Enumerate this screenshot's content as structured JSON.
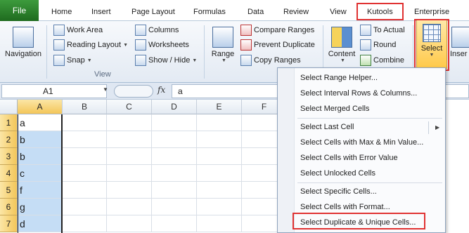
{
  "tabs": {
    "file": "File",
    "home": "Home",
    "insert": "Insert",
    "page_layout": "Page Layout",
    "formulas": "Formulas",
    "data": "Data",
    "review": "Review",
    "view": "View",
    "kutools": "Kutools",
    "enterprise": "Enterprise"
  },
  "ribbon": {
    "navigation": "Navigation",
    "work_area": "Work Area",
    "reading_layout": "Reading Layout",
    "snap": "Snap",
    "columns": "Columns",
    "worksheets": "Worksheets",
    "show_hide": "Show / Hide",
    "view_group": "View",
    "range": "Range",
    "compare_ranges": "Compare Ranges",
    "prevent_duplicate": "Prevent Duplicate",
    "copy_ranges": "Copy Ranges",
    "content": "Content",
    "to_actual": "To Actual",
    "round": "Round",
    "combine": "Combine",
    "select": "Select",
    "insert": "Inser"
  },
  "formula_bar": {
    "name_box": "A1",
    "fx": "fx",
    "value": "a"
  },
  "sheet": {
    "columns": [
      "A",
      "B",
      "C",
      "D",
      "E",
      "F"
    ],
    "rows": [
      "1",
      "2",
      "3",
      "4",
      "5",
      "6",
      "7"
    ],
    "col_a_values": [
      "a",
      "b",
      "b",
      "c",
      "f",
      "g",
      "d"
    ]
  },
  "menu": {
    "items": [
      "Select Range Helper...",
      "Select Interval Rows & Columns...",
      "Select Merged Cells",
      "Select Last Cell",
      "Select Cells with Max & Min Value...",
      "Select Cells with Error Value",
      "Select Unlocked Cells",
      "Select Specific Cells...",
      "Select Cells with Format...",
      "Select Duplicate & Unique Cells..."
    ]
  },
  "colors": {
    "highlight_box": "#e03232",
    "file_tab": "#2d7a2d",
    "selection_fill": "#c5ddf5",
    "header_selected": "#f3c659"
  }
}
